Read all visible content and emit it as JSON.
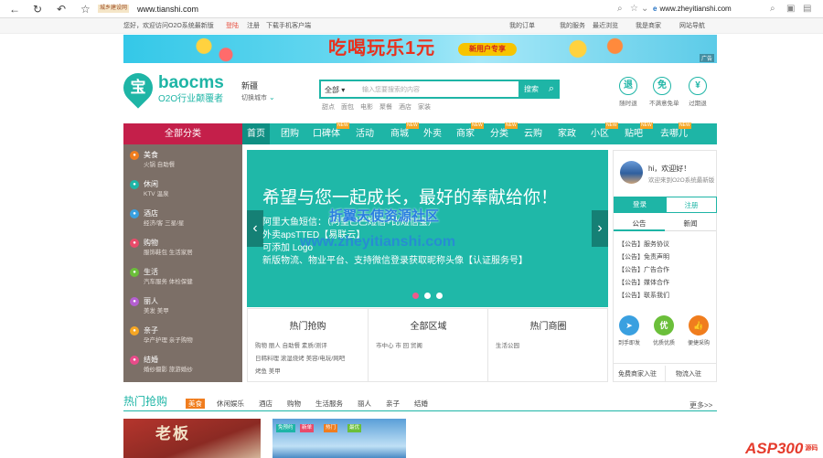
{
  "browser": {
    "url_tag": "城乡建设网",
    "url": "www.tianshi.com",
    "second_url": "www.zheyitianshi.com"
  },
  "topbar": {
    "greeting": "您好，欢迎访问O2O系统最新版",
    "login": "登陆",
    "register": "注册",
    "download": "下载手机客户端",
    "links": [
      "我的订单",
      "我的服务",
      "最近浏览",
      "我是商家",
      "网站导航"
    ]
  },
  "ad": {
    "headline": "吃喝玩乐1元",
    "tag": "新用户专享",
    "label": "广告"
  },
  "header": {
    "logo_char": "宝",
    "logo_name": "baocms",
    "slogan": "O2O行业颠覆者",
    "city": "新疆",
    "switch_city": "切换城市",
    "search_select": "全部",
    "search_placeholder": "输入您要搜索的内容",
    "search_button": "搜索",
    "hot_words": [
      "甜点",
      "面包",
      "电影",
      "聚餐",
      "酒店",
      "家装"
    ],
    "services": [
      {
        "icon": "退",
        "label": "随时退"
      },
      {
        "icon": "免",
        "label": "不满意免单"
      },
      {
        "icon": "¥",
        "label": "过期退"
      }
    ]
  },
  "nav": {
    "all_categories": "全部分类",
    "items": [
      {
        "label": "首页",
        "hot": ""
      },
      {
        "label": "团购",
        "hot": ""
      },
      {
        "label": "口碑体",
        "hot": "NEW"
      },
      {
        "label": "活动",
        "hot": ""
      },
      {
        "label": "商城",
        "hot": "NEW"
      },
      {
        "label": "外卖",
        "hot": ""
      },
      {
        "label": "商家",
        "hot": "NEW"
      },
      {
        "label": "分类",
        "hot": "NEW"
      },
      {
        "label": "云购",
        "hot": ""
      },
      {
        "label": "家政",
        "hot": ""
      },
      {
        "label": "小区",
        "hot": "NEW"
      },
      {
        "label": "贴吧",
        "hot": "NEW"
      },
      {
        "label": "去哪儿",
        "hot": "NEW"
      }
    ]
  },
  "sidebar": {
    "categories": [
      {
        "name": "美食",
        "sub": "火锅  自助餐",
        "icon": "food-icon",
        "color": "#f07d1e"
      },
      {
        "name": "休闲",
        "sub": "KTV  温泉",
        "icon": "leisure-icon",
        "color": "#1eb5a6"
      },
      {
        "name": "酒店",
        "sub": "经济/客  三星/星",
        "icon": "hotel-icon",
        "color": "#3aa0e0"
      },
      {
        "name": "购物",
        "sub": "服饰鞋包  生活家居",
        "icon": "shopping-icon",
        "color": "#e94b6a"
      },
      {
        "name": "生活",
        "sub": "汽车服务  体检保健",
        "icon": "life-icon",
        "color": "#6bbf3a"
      },
      {
        "name": "丽人",
        "sub": "美发  美甲",
        "icon": "beauty-icon",
        "color": "#b45fd1"
      },
      {
        "name": "亲子",
        "sub": "孕产护理  亲子购物",
        "icon": "family-icon",
        "color": "#f5a623"
      },
      {
        "name": "结婚",
        "sub": "婚纱摄影  旅游婚纱",
        "icon": "wedding-icon",
        "color": "#e94b8a"
      }
    ]
  },
  "slider": {
    "headline": "希望与您一起成长，最好的奉献给你！",
    "lines": [
      "阿里大鱼短信：（阿里巴巴短信+比短信宝）",
      "外卖apsTTED【易联云】",
      "可添加 Logo",
      "新版物流、物业平台、支持微信登录获取昵称头像【认证服务号】"
    ],
    "watermark1": "折翼天使资源社区",
    "watermark2": "www.zheyitianshi.com",
    "prev": "‹",
    "next": "›"
  },
  "hot_blocks": [
    {
      "title": "热门抢购",
      "lines": [
        "购物  丽人  自助餐  素质/测评",
        "日韩料理  滚湿烧烤  美容/电玩/网吧",
        "烤鱼  美甲"
      ]
    },
    {
      "title": "全部区域",
      "lines": [
        "市中心  市  回  贸阁"
      ]
    },
    {
      "title": "热门商圈",
      "lines": [
        "生活公园"
      ]
    }
  ],
  "user_panel": {
    "greeting": "hi，欢迎好！",
    "welcome": "欢迎来到O2O系统最新版",
    "login_btn": "登录",
    "register_btn": "注册",
    "tabs": [
      "公告",
      "新闻"
    ],
    "notices": [
      "【公告】服务协议",
      "【公告】免责声明",
      "【公告】广告合作",
      "【公告】媒体合作",
      "【公告】联系我们"
    ],
    "quick": [
      {
        "icon": "➤",
        "label": "到手即发",
        "color": "#3aa0e0"
      },
      {
        "icon": "优",
        "label": "优质优质",
        "color": "#6bbf3a"
      },
      {
        "icon": "👍",
        "label": "便捷采购",
        "color": "#f07d1e"
      }
    ],
    "footer": [
      "免费商家入驻",
      "物流入驻"
    ]
  },
  "hot_section": {
    "title": "热门抢购",
    "tabs": [
      "美食",
      "休闲娱乐",
      "酒店",
      "购物",
      "生活服务",
      "丽人",
      "亲子",
      "结婚"
    ],
    "more": "更多>>",
    "card1_sign": "老板",
    "card2_tags": [
      "免预约",
      "新单",
      "热门",
      "最优"
    ]
  },
  "watermark_logo": {
    "brand": "ASP300",
    "suffix": "源码"
  }
}
